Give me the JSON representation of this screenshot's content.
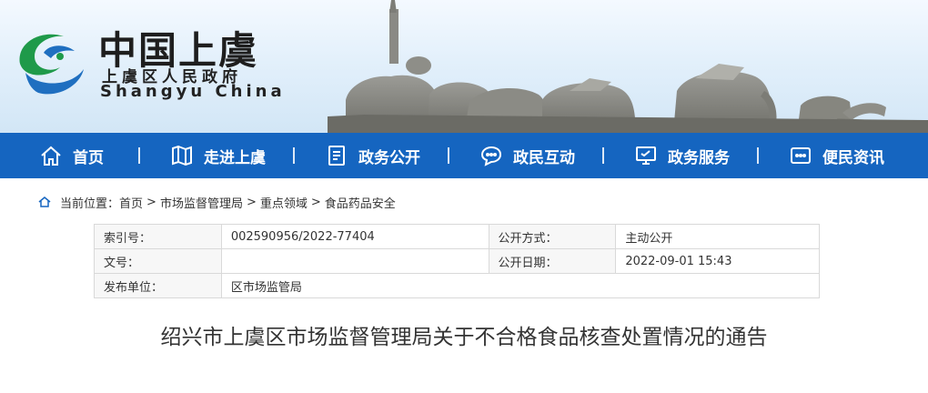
{
  "header": {
    "logo_cn": "中国上虞",
    "logo_sub": "上虞区人民政府",
    "logo_en": "Shangyu China"
  },
  "nav": {
    "items": [
      {
        "label": "首页",
        "icon": "home-icon"
      },
      {
        "label": "走进上虞",
        "icon": "map-icon"
      },
      {
        "label": "政务公开",
        "icon": "document-icon"
      },
      {
        "label": "政民互动",
        "icon": "chat-icon"
      },
      {
        "label": "政务服务",
        "icon": "monitor-icon"
      },
      {
        "label": "便民资讯",
        "icon": "info-board-icon"
      }
    ]
  },
  "breadcrumb": {
    "prefix": "当前位置：",
    "items": [
      "首页",
      "市场监督管理局",
      "重点领域",
      "食品药品安全"
    ],
    "separator": ">"
  },
  "meta": {
    "index_label": "索引号：",
    "index_value": "002590956/2022-77404",
    "open_mode_label": "公开方式：",
    "open_mode_value": "主动公开",
    "doc_no_label": "文号：",
    "doc_no_value": "",
    "open_date_label": "公开日期：",
    "open_date_value": "2022-09-01 15:43",
    "issuer_label": "发布单位：",
    "issuer_value": "区市场监管局"
  },
  "article": {
    "title": "绍兴市上虞区市场监督管理局关于不合格食品核查处置情况的通告"
  },
  "colors": {
    "nav_bg": "#1565c0",
    "logo_green": "#1f9a4a",
    "logo_blue": "#1f6fc0"
  }
}
